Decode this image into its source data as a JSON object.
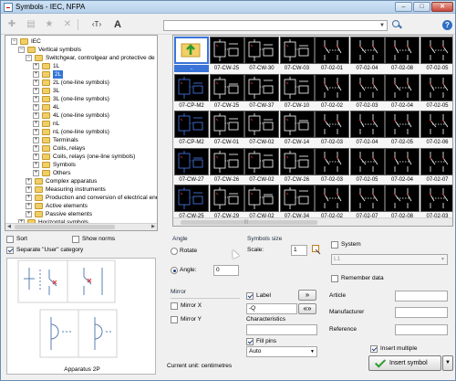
{
  "window": {
    "title": "Symbols - IEC, NFPA"
  },
  "toolbar": {
    "add_icon": "plus-icon",
    "text_icon_label": "‹T›",
    "text_size_label": "A",
    "search": {
      "value": "",
      "placeholder": ""
    },
    "help_label": "?"
  },
  "tree": {
    "items": [
      {
        "label": "IEC",
        "expander": "−"
      },
      {
        "label": "Vertical symbols",
        "expander": "−"
      },
      {
        "label": "Switchgear, controlgear and protective de",
        "expander": "−"
      },
      {
        "label": "1L",
        "expander": "+"
      },
      {
        "label": "2L",
        "expander": "+"
      },
      {
        "label": "2L (one-line symbols)",
        "expander": "+"
      },
      {
        "label": "3L",
        "expander": "+"
      },
      {
        "label": "3L (one-line symbols)",
        "expander": "+"
      },
      {
        "label": "4L",
        "expander": "+"
      },
      {
        "label": "4L (one-line symbols)",
        "expander": "+"
      },
      {
        "label": "nL",
        "expander": "+"
      },
      {
        "label": "nL (one-line symbols)",
        "expander": "+"
      },
      {
        "label": "Terminals",
        "expander": "+"
      },
      {
        "label": "Coils, relays",
        "expander": "+"
      },
      {
        "label": "Coils, relays (one-line symbols)",
        "expander": "+"
      },
      {
        "label": "Symbols",
        "expander": "+"
      },
      {
        "label": "Others",
        "expander": "+"
      },
      {
        "label": "Complex apparatus",
        "expander": "+"
      },
      {
        "label": "Measuring instruments",
        "expander": "+"
      },
      {
        "label": "Production and conversion of electrical ene",
        "expander": "+"
      },
      {
        "label": "Active elements",
        "expander": "+"
      },
      {
        "label": "Passive elements",
        "expander": "+"
      },
      {
        "label": "Horizontal symbols",
        "expander": "+"
      }
    ],
    "selected_index": 4
  },
  "symbols": {
    "rows": [
      [
        "..",
        "07-CW-25",
        "07-CW-30",
        "07-CW-03",
        "07-02-01",
        "07-02-04",
        "07-02-08",
        "07-02-05"
      ],
      [
        "07-CP-M2",
        "07-CW-25",
        "07-CW-37",
        "07-CW-10",
        "07-02-02",
        "07-02-03",
        "07-02-04",
        "07-02-05"
      ],
      [
        "07-CP-M2",
        "07-CW-01",
        "07-CW-02",
        "07-CW-14",
        "07-02-03",
        "07-02-04",
        "07-02-05",
        "07-02-06"
      ],
      [
        "07-CW-27",
        "07-CW-26",
        "07-CW-02",
        "07-CW-26",
        "07-02-03",
        "07-02-05",
        "07-02-04",
        "07-02-07"
      ],
      [
        "07-CW-25",
        "07-CW-29",
        "07-CW-02",
        "07-CW-34",
        "07-02-02",
        "07-02-07",
        "07-02-08",
        "07-02-03"
      ]
    ],
    "selected_label": ".."
  },
  "options": {
    "sort_label": "Sort",
    "sort_checked": false,
    "show_norms_label": "Show norms",
    "show_norms_checked": false,
    "separate_user_label": "Separate \"User\" category",
    "separate_user_checked": true
  },
  "angle": {
    "title": "Angle",
    "rotate_label": "Rotate",
    "angle_label": "Angle:",
    "angle_value": "0",
    "selected": "angle"
  },
  "symbols_size": {
    "title": "Symbols size",
    "scale_label": "Scale:",
    "scale_value": "1"
  },
  "mirror": {
    "title": "Mirror",
    "mirror_x_label": "Mirror X",
    "mirror_x_checked": false,
    "mirror_y_label": "Mirror Y",
    "mirror_y_checked": false
  },
  "label": {
    "label_text": "Label",
    "label_checked": true,
    "label_value": "-Q",
    "characteristics_label": "Characteristics",
    "characteristics_value": "",
    "fill_pins_label": "Fill pins",
    "fill_pins_checked": true,
    "fill_pins_value": "Auto",
    "arrow_btn_1": "»",
    "arrow_btn_2": "«»"
  },
  "system": {
    "system_label": "System",
    "system_checked": false,
    "system_value": "L1",
    "remember_label": "Remember data",
    "remember_checked": false,
    "article_label": "Article",
    "article_value": "",
    "manufacturer_label": "Manufacturer",
    "manufacturer_value": "",
    "reference_label": "Reference",
    "reference_value": ""
  },
  "preview": {
    "caption": "Apparatus 2P"
  },
  "footer": {
    "current_unit": "Current unit: centimetres",
    "insert_multiple_label": "Insert multiple",
    "insert_multiple_checked": true,
    "insert_symbol_label": "Insert symbol"
  },
  "colors": {
    "selection": "#3375d6",
    "thumb_bg": "#000000",
    "symbol_line": "#ffffff",
    "symbol_accent": "#e03030",
    "check_green": "#2d9a2d"
  }
}
